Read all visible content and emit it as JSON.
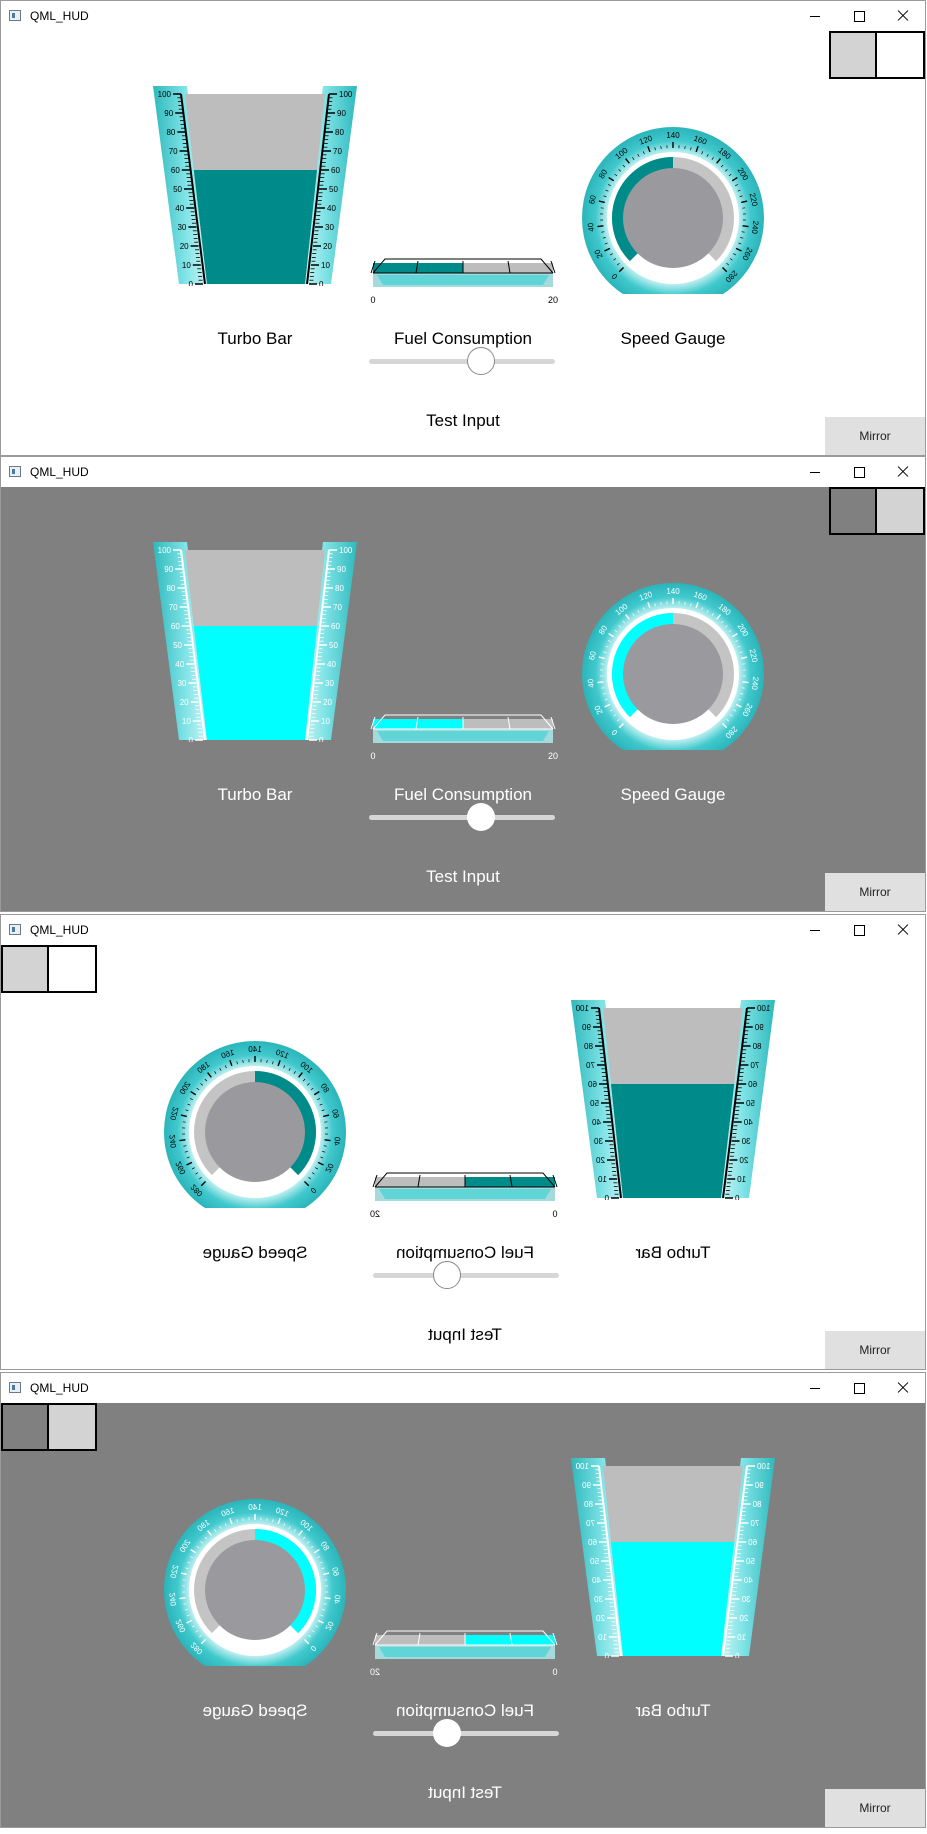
{
  "windows": [
    {
      "title": "QML_HUD",
      "theme": "light",
      "mirrored": false,
      "turbo_level": 60,
      "fuel_value": 10,
      "speed_value": 140,
      "slider_value": 0.6,
      "toggle_left": "light",
      "toggle_right": "white"
    },
    {
      "title": "QML_HUD",
      "theme": "dark",
      "mirrored": false,
      "turbo_level": 60,
      "fuel_value": 10,
      "speed_value": 140,
      "slider_value": 0.6,
      "toggle_left": "grey",
      "toggle_right": "light"
    },
    {
      "title": "QML_HUD",
      "theme": "light",
      "mirrored": true,
      "turbo_level": 60,
      "fuel_value": 10,
      "speed_value": 140,
      "slider_value": 0.6,
      "toggle_left": "light",
      "toggle_right": "white"
    },
    {
      "title": "QML_HUD",
      "theme": "dark",
      "mirrored": true,
      "turbo_level": 60,
      "fuel_value": 10,
      "speed_value": 140,
      "slider_value": 0.6,
      "toggle_left": "grey",
      "toggle_right": "light"
    }
  ],
  "labels": {
    "turbo": "Turbo Bar",
    "fuel": "Fuel Consumption",
    "speed": "Speed Gauge",
    "test_input": "Test Input",
    "mirror_button": "Mirror"
  },
  "turbo_ticks": [
    "0",
    "10",
    "20",
    "30",
    "40",
    "50",
    "60",
    "70",
    "80",
    "90",
    "100"
  ],
  "fuel_ticks": [
    "0",
    "20"
  ],
  "speed_ticks": [
    "0",
    "20",
    "40",
    "60",
    "80",
    "100",
    "120",
    "140",
    "160",
    "180",
    "200",
    "220",
    "240",
    "260",
    "280"
  ],
  "colors": {
    "accent_light": "#008b8b",
    "accent_dark": "#00ffff",
    "bezel": "#33c3c8",
    "empty_fill": "#bdbdbd",
    "dial_face": "#9a999e",
    "dark_bg": "#808080",
    "toggle_light": "#d3d3d3",
    "toggle_white": "#ffffff",
    "toggle_grey": "#808080"
  }
}
